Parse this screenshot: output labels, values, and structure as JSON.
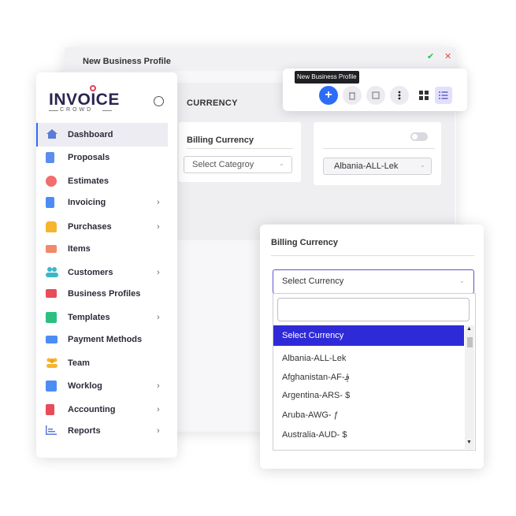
{
  "back_window": {
    "title": "New Business Profile",
    "section_title": "CURRENCY",
    "billing_label": "Billing Currency",
    "category_select": "Select Categroy",
    "currency_value": "Albania-ALL-Lek"
  },
  "toolbar": {
    "tooltip": "New Business Profile"
  },
  "logo": {
    "main": "INVOICE",
    "sub": "CROWD"
  },
  "sidebar": {
    "items": [
      {
        "label": "Dashboard",
        "icon": "home-icon",
        "color": "#5b7bd5"
      },
      {
        "label": "Proposals",
        "icon": "document-icon",
        "color": "#5b8def"
      },
      {
        "label": "Estimates",
        "icon": "pie-chart-icon",
        "color": "#f26d6d"
      },
      {
        "label": "Invoicing",
        "icon": "invoice-icon",
        "color": "#4c8df5"
      },
      {
        "label": "Purchases",
        "icon": "bag-icon",
        "color": "#f5b52e"
      },
      {
        "label": "Items",
        "icon": "box-icon",
        "color": "#f08a6a"
      },
      {
        "label": "Customers",
        "icon": "users-icon",
        "color": "#3bb7c9"
      },
      {
        "label": "Business Profiles",
        "icon": "briefcase-icon",
        "color": "#e84c5a"
      },
      {
        "label": "Templates",
        "icon": "templates-icon",
        "color": "#2dbf80"
      },
      {
        "label": "Payment Methods",
        "icon": "card-icon",
        "color": "#4c8df5"
      },
      {
        "label": "Team",
        "icon": "team-icon",
        "color": "#f5b52e"
      },
      {
        "label": "Worklog",
        "icon": "calendar-icon",
        "color": "#4c8df5"
      },
      {
        "label": "Accounting",
        "icon": "calculator-icon",
        "color": "#e84c5a"
      },
      {
        "label": "Reports",
        "icon": "chart-icon",
        "color": "#5b7bd5"
      }
    ]
  },
  "panel": {
    "title": "Billing Currency",
    "select_value": "Select Currency",
    "highlighted_option": "Select Currency",
    "options": [
      "Albania-ALL-Lek",
      "Afghanistan-AF-؋",
      "Argentina-ARS- $",
      "Aruba-AWG- ƒ",
      "Australia-AUD- $"
    ]
  },
  "colors": {
    "accent": "#2d6df6",
    "highlight": "#2f2ad8",
    "brand": "#2a2550",
    "brand_dot": "#e53e5c"
  }
}
